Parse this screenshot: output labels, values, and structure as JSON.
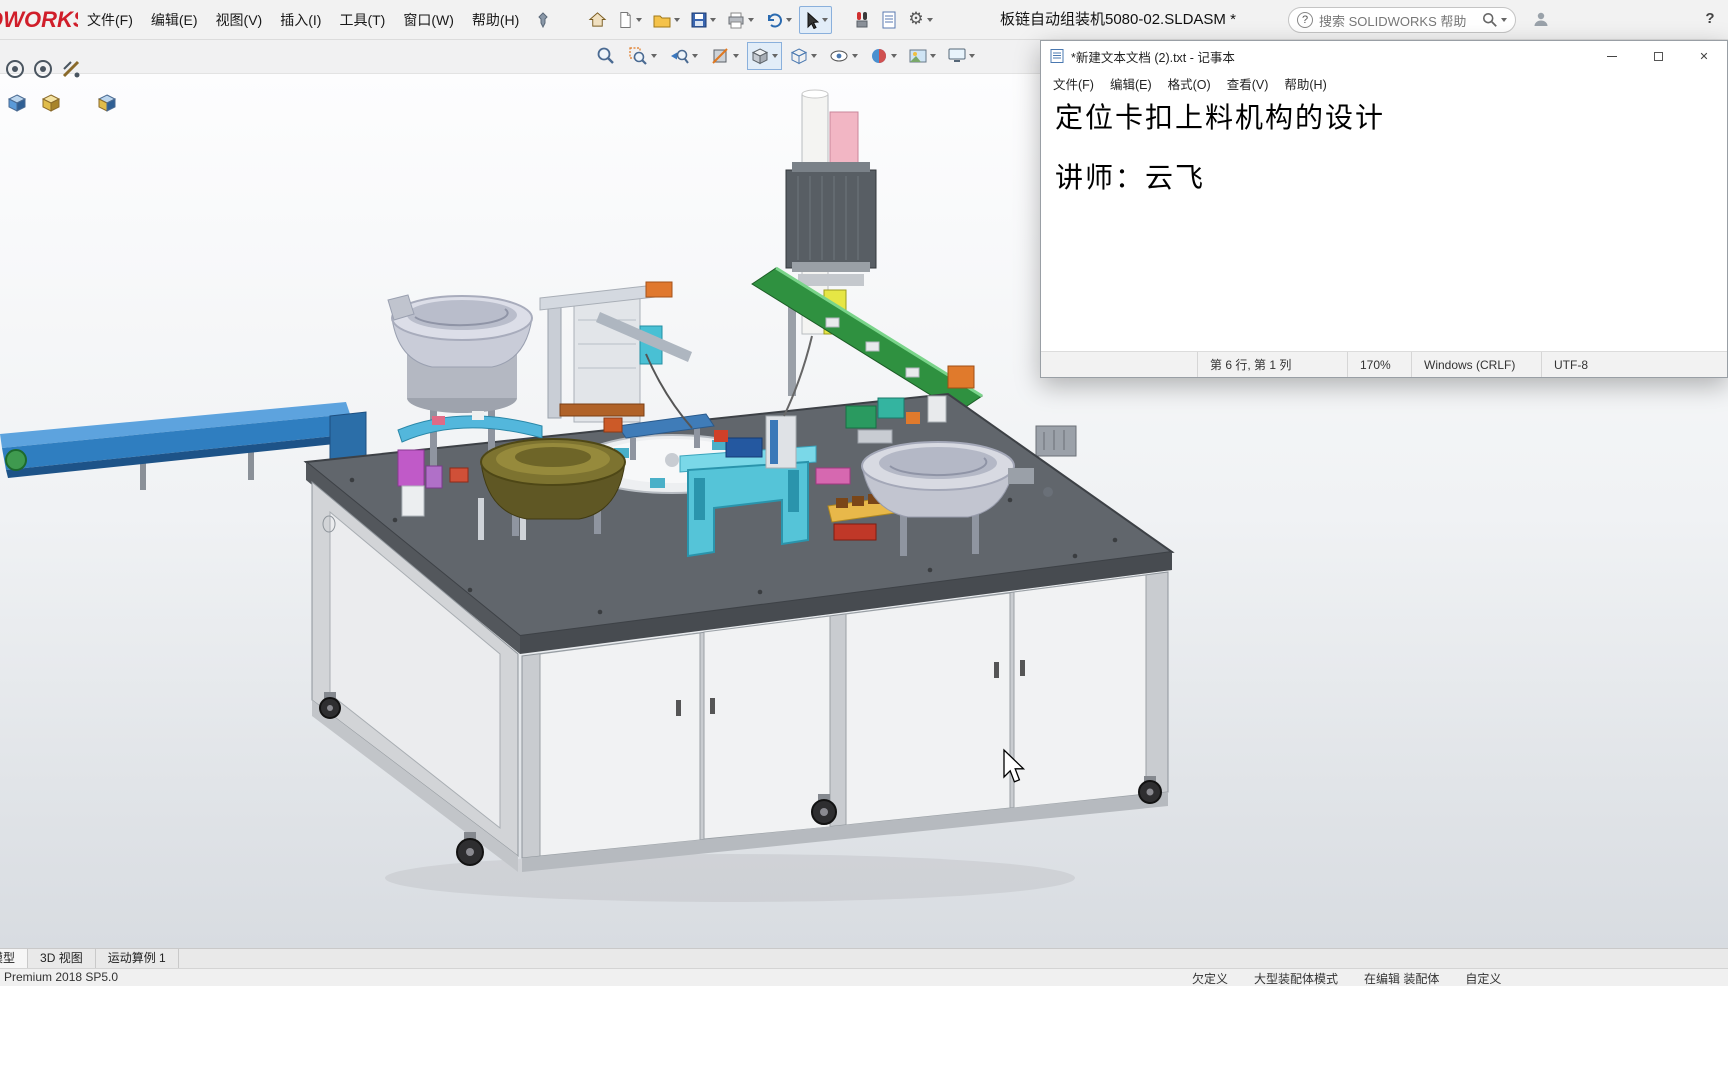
{
  "colors": {
    "brand_red": "#d01e2a",
    "toolbar_bg": "#f2f2f2",
    "table_top_gray": "#61666c",
    "conveyor_blue": "#2f7ec0",
    "belt_green": "#2f9140",
    "bowl_brass_olive": "#7d7330",
    "fixture_cyan": "#55c4d8"
  },
  "solidworks": {
    "logo_text": "SOLIDWORKS",
    "menus": [
      "文件(F)",
      "编辑(E)",
      "视图(V)",
      "插入(I)",
      "工具(T)",
      "窗口(W)",
      "帮助(H)"
    ],
    "document_title": "板链自动组装机5080-02.SLDASM *",
    "search_placeholder": "搜索 SOLIDWORKS 帮助",
    "toolbar_icons": [
      "pin-icon",
      "home-icon",
      "new-document-icon",
      "open-icon",
      "save-icon",
      "print-icon",
      "undo-icon",
      "select-cursor-icon",
      "toolbox-addin-icon",
      "design-report-icon",
      "options-gear-icon"
    ],
    "headsup_icons": [
      "zoom-fit-icon",
      "zoom-area-icon",
      "previous-view-icon",
      "section-view-icon",
      "view-orientation-icon",
      "display-style-icon",
      "hide-show-items-icon",
      "edit-appearance-icon",
      "apply-scene-icon",
      "view-settings-icon"
    ],
    "left_view_icons": [
      "target-circle-icon",
      "target-circle-icon",
      "measure-icon",
      "assembly-cube-blue-icon",
      "assembly-cube-yellow-icon",
      "assembly-cube-mixed-icon"
    ],
    "tabs": [
      "模型",
      "3D 视图",
      "运动算例 1"
    ],
    "status_left": "Premium 2018 SP5.0",
    "status_right": [
      "欠定义",
      "大型装配体模式",
      "在编辑 装配体",
      "自定义"
    ]
  },
  "notepad": {
    "window_title": "*新建文本文档 (2).txt - 记事本",
    "menus": [
      "文件(F)",
      "编辑(E)",
      "格式(O)",
      "查看(V)",
      "帮助(H)"
    ],
    "lines": [
      "定位卡扣上料机构的设计",
      "",
      "讲师：云飞"
    ],
    "status": {
      "line_col": "第 6 行, 第 1 列",
      "zoom": "170%",
      "line_ending": "Windows (CRLF)",
      "encoding": "UTF-8"
    }
  }
}
